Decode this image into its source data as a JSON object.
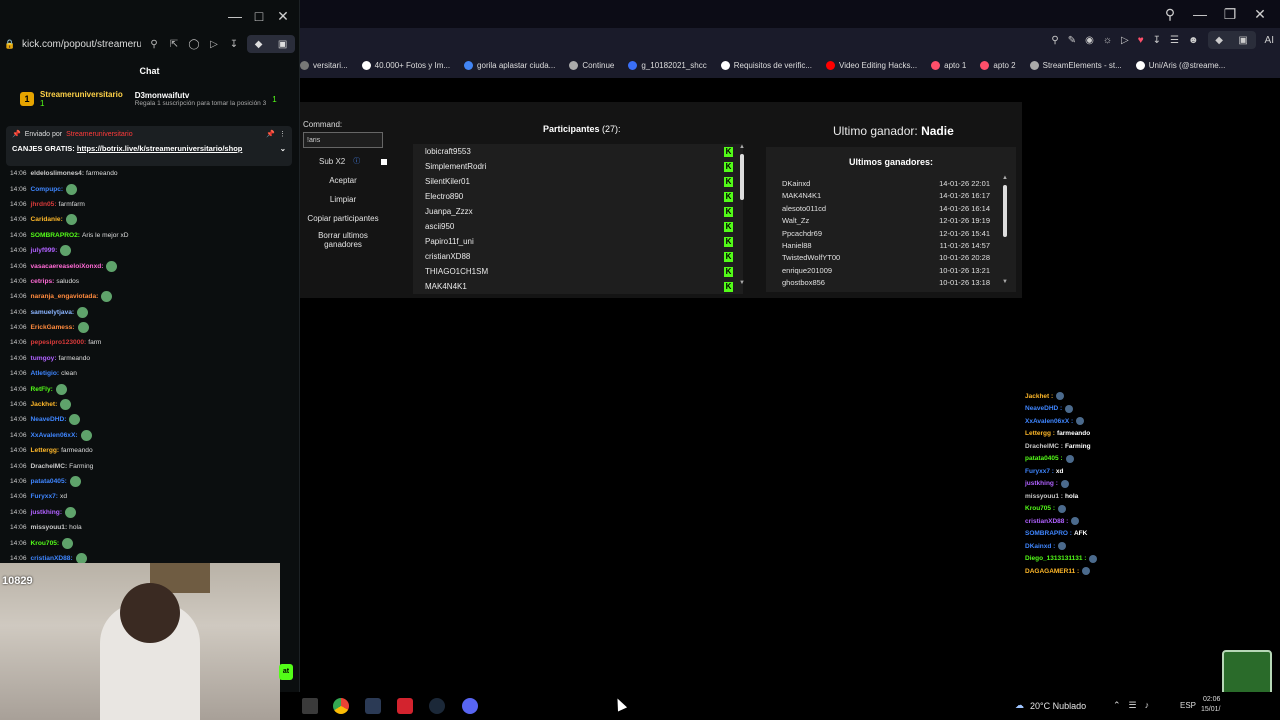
{
  "chat_window": {
    "url": "kick.com/popout/streameruni",
    "header": "Chat",
    "gifter": {
      "rank": "1",
      "name": "Streameruniversitario",
      "count_left": "1",
      "count_right": "1",
      "recipient": "D3monwaifutv",
      "regala": "Regala 1 suscripción para tomar la posición 3"
    },
    "pinned": {
      "label": "Enviado por",
      "sender": "Streameruniversitario",
      "message_prefix": "CANJES GRATIS:",
      "link": "https://botrix.live/k/streameruniversitario/shop"
    },
    "messages": [
      {
        "time": "14:06",
        "user": "eldeloslimones4:",
        "color": "#c9c9c9",
        "text": "farmeando"
      },
      {
        "time": "14:06",
        "user": "Compupc:",
        "color": "#3f86ff",
        "text": ""
      },
      {
        "time": "14:06",
        "user": "jhrdn05:",
        "color": "#d83a3a",
        "text": "farmfarm"
      },
      {
        "time": "14:06",
        "user": "Caridanie:",
        "color": "#ffb829",
        "text": ""
      },
      {
        "time": "14:06",
        "user": "SOMBRAPRO2:",
        "color": "#53fc18",
        "text": "Aris le mejor xD"
      },
      {
        "time": "14:06",
        "user": "julyf999:",
        "color": "#b061ff",
        "text": ""
      },
      {
        "time": "14:06",
        "user": "vasacaereaseloiXonxd:",
        "color": "#ff6ad5",
        "text": ""
      },
      {
        "time": "14:06",
        "user": "cetrips:",
        "color": "#ff6ad5",
        "text": "saludos"
      },
      {
        "time": "14:06",
        "user": "naranja_engaviotada:",
        "color": "#ff8a3d",
        "text": ""
      },
      {
        "time": "14:06",
        "user": "samuelytjava:",
        "color": "#8ab4ff",
        "text": ""
      },
      {
        "time": "14:06",
        "user": "ErickGamess:",
        "color": "#ff8a3d",
        "text": ""
      },
      {
        "time": "14:06",
        "user": "pepesipro123000:",
        "color": "#d83a3a",
        "text": "farm"
      },
      {
        "time": "14:06",
        "user": "tumgoy:",
        "color": "#b061ff",
        "text": "farmeando"
      },
      {
        "time": "14:06",
        "user": "Atletigio:",
        "color": "#3f86ff",
        "text": "clean"
      },
      {
        "time": "14:06",
        "user": "RetFly:",
        "color": "#53fc18",
        "text": ""
      },
      {
        "time": "14:06",
        "user": "Jackhet:",
        "color": "#ffb829",
        "text": ""
      },
      {
        "time": "14:06",
        "user": "NeaveDHD:",
        "color": "#3f86ff",
        "text": ""
      },
      {
        "time": "14:06",
        "user": "XxAvalen06xX:",
        "color": "#3f86ff",
        "text": ""
      },
      {
        "time": "14:06",
        "user": "Lettergg:",
        "color": "#ffb829",
        "text": "farmeando"
      },
      {
        "time": "14:06",
        "user": "DrachelMC:",
        "color": "#c9c9c9",
        "text": "Farming"
      },
      {
        "time": "14:06",
        "user": "patata0405:",
        "color": "#3f86ff",
        "text": ""
      },
      {
        "time": "14:06",
        "user": "Furyxx7:",
        "color": "#3f86ff",
        "text": "xd"
      },
      {
        "time": "14:06",
        "user": "justkhing:",
        "color": "#b061ff",
        "text": ""
      },
      {
        "time": "14:06",
        "user": "missyouu1:",
        "color": "#c9c9c9",
        "text": "hola"
      },
      {
        "time": "14:06",
        "user": "Krou705:",
        "color": "#53fc18",
        "text": ""
      },
      {
        "time": "14:06",
        "user": "cristianXD88:",
        "color": "#3f86ff",
        "text": ""
      }
    ],
    "viewer_count": "10829"
  },
  "browser": {
    "bookmarks": [
      {
        "label": "versitari...",
        "color": "#777"
      },
      {
        "label": "40.000+ Fotos y Im...",
        "color": "#fff"
      },
      {
        "label": "gorila aplastar ciuda...",
        "color": "#4285f4"
      },
      {
        "label": "Continue",
        "color": "#aaa"
      },
      {
        "label": "g_10182021_shcc",
        "color": "#3a6ff7"
      },
      {
        "label": "Requisitos de verific...",
        "color": "#fff"
      },
      {
        "label": "Video Editing Hacks...",
        "color": "#ff0000"
      },
      {
        "label": "apto 1",
        "color": "#ff4f6a"
      },
      {
        "label": "apto 2",
        "color": "#ff4f6a"
      },
      {
        "label": "StreamElements - st...",
        "color": "#aaa"
      },
      {
        "label": "Uni/Aris (@streame...",
        "color": "#fff"
      }
    ]
  },
  "giveaway": {
    "command_label": "Command:",
    "command_value": "!aris",
    "buttons": {
      "sub_x2": "Sub X2",
      "accept": "Aceptar",
      "clear": "Limpiar",
      "copy": "Copiar participantes",
      "delete_winners": "Borrar ultimos ganadores"
    },
    "participants_label": "Participantes",
    "participants_count": "(27):",
    "participants": [
      "lobicraft9553",
      "SimplementRodri",
      "SilentKiler01",
      "Electro890",
      "Juanpa_Zzzx",
      "ascii950",
      "Papiro11f_uni",
      "cristianXD88",
      "THIAGO1CH1SM",
      "MAK4N4K1"
    ],
    "last_winner_label": "Ultimo ganador:",
    "last_winner": "Nadie",
    "winners_header": "Ultimos ganadores:",
    "winners": [
      {
        "name": "DKainxd",
        "date": "14-01-26 22:01"
      },
      {
        "name": "MAK4N4K1",
        "date": "14-01-26 16:17"
      },
      {
        "name": "alesoto011cd",
        "date": "14-01-26 16:14"
      },
      {
        "name": "Walt_Zz",
        "date": "12-01-26 19:19"
      },
      {
        "name": "Ppcachdr69",
        "date": "12-01-26 15:41"
      },
      {
        "name": "Haniel88",
        "date": "11-01-26 14:57"
      },
      {
        "name": "TwistedWolfYT00",
        "date": "10-01-26 20:28"
      },
      {
        "name": "enrique201009",
        "date": "10-01-26 13:21"
      },
      {
        "name": "ghostbox856",
        "date": "10-01-26 13:18"
      }
    ]
  },
  "overlay_chat": [
    {
      "user": "Jackhet",
      "color": "#ffb829",
      "text": ""
    },
    {
      "user": "NeaveDHD",
      "color": "#3f86ff",
      "text": ""
    },
    {
      "user": "XxAvalen06xX",
      "color": "#3f86ff",
      "text": ""
    },
    {
      "user": "Lettergg",
      "color": "#ffb829",
      "text": "farmeando"
    },
    {
      "user": "DrachelMC",
      "color": "#c9c9c9",
      "text": "Farming"
    },
    {
      "user": "patata0405",
      "color": "#53fc18",
      "text": ""
    },
    {
      "user": "Furyxx7",
      "color": "#3f86ff",
      "text": "xd"
    },
    {
      "user": "justkhing",
      "color": "#b061ff",
      "text": ""
    },
    {
      "user": "missyouu1",
      "color": "#c9c9c9",
      "text": "hola"
    },
    {
      "user": "Krou705",
      "color": "#53fc18",
      "text": ""
    },
    {
      "user": "cristianXD88",
      "color": "#b061ff",
      "text": ""
    },
    {
      "user": "SOMBRAPRO",
      "color": "#3f86ff",
      "text": "AFK"
    },
    {
      "user": "DKainxd",
      "color": "#3f86ff",
      "text": ""
    },
    {
      "user": "Diego_1313131131",
      "color": "#53fc18",
      "text": ""
    },
    {
      "user": "DAGAGAMER11",
      "color": "#ffb829",
      "text": ""
    }
  ],
  "taskbar": {
    "weather": "20°C Nublado",
    "lang": "ESP",
    "time": "02:06",
    "date": "15/01/"
  }
}
